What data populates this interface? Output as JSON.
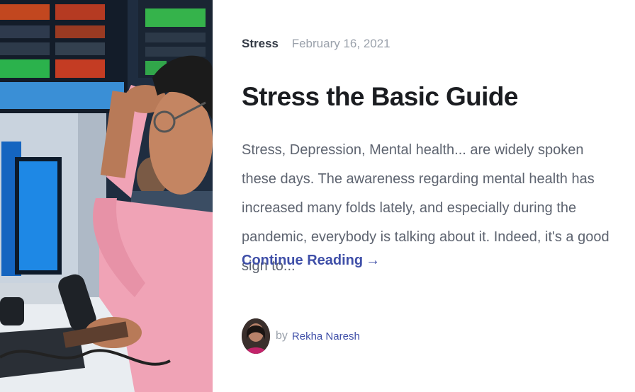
{
  "post": {
    "category": "Stress",
    "date": "February 16, 2021",
    "title": "Stress the Basic Guide",
    "excerpt": "Stress, Depression, Mental health... are widely spoken these days. The awareness regarding mental health has increased many folds lately, and especially during the pandemic, everybody is talking about it. Indeed, it's a good sign to...",
    "read_more_label": "Continue Reading",
    "read_more_arrow": "→"
  },
  "author": {
    "by_label": "by",
    "name": "Rekha Naresh"
  },
  "colors": {
    "accent": "#3f4fa8",
    "title": "#1b1d21",
    "body_text": "#5e6470",
    "muted": "#9aa1ab"
  }
}
